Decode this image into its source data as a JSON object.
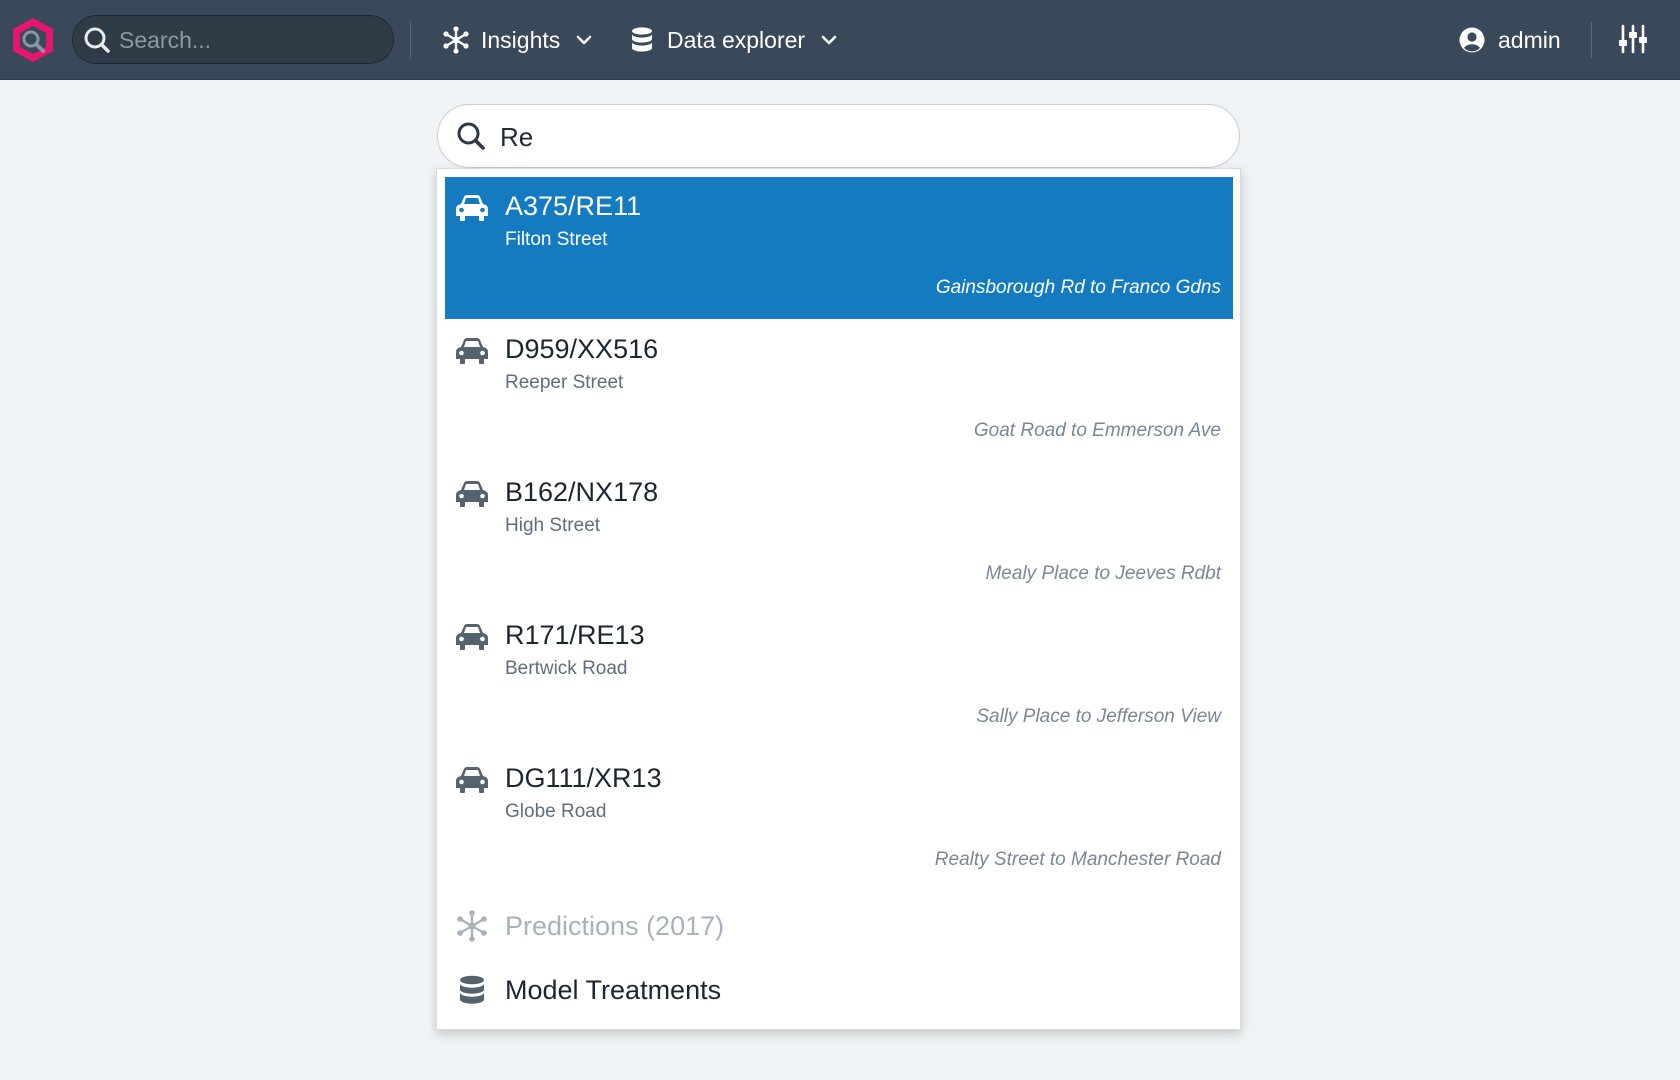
{
  "navbar": {
    "search_placeholder": "Search...",
    "menus": [
      {
        "label": "Insights",
        "icon": "insights-icon"
      },
      {
        "label": "Data explorer",
        "icon": "database-icon"
      }
    ],
    "user": {
      "label": "admin",
      "icon": "user-circle-icon"
    },
    "settings_icon": "sliders-icon",
    "colors": {
      "background": "#3a4959",
      "logo": "#e4176c"
    }
  },
  "main_search": {
    "value": "Re",
    "icon": "search-icon"
  },
  "results": [
    {
      "title": "A375/RE11",
      "street": "Filton Street",
      "range": "Gainsborough Rd to Franco Gdns",
      "active": true
    },
    {
      "title": "D959/XX516",
      "street": "Reeper Street",
      "range": "Goat Road to Emmerson Ave",
      "active": false
    },
    {
      "title": "B162/NX178",
      "street": "High Street",
      "range": "Mealy Place to Jeeves Rdbt",
      "active": false
    },
    {
      "title": "R171/RE13",
      "street": "Bertwick Road",
      "range": "Sally Place to Jefferson View",
      "active": false
    },
    {
      "title": "DG111/XR13",
      "street": "Globe Road",
      "range": "Realty Street to Manchester Road",
      "active": false
    }
  ],
  "extras": [
    {
      "label": "Predictions (2017)",
      "icon": "insights-icon"
    },
    {
      "label": "Model Treatments",
      "icon": "database-icon"
    }
  ],
  "accent_color": "#147bc1"
}
